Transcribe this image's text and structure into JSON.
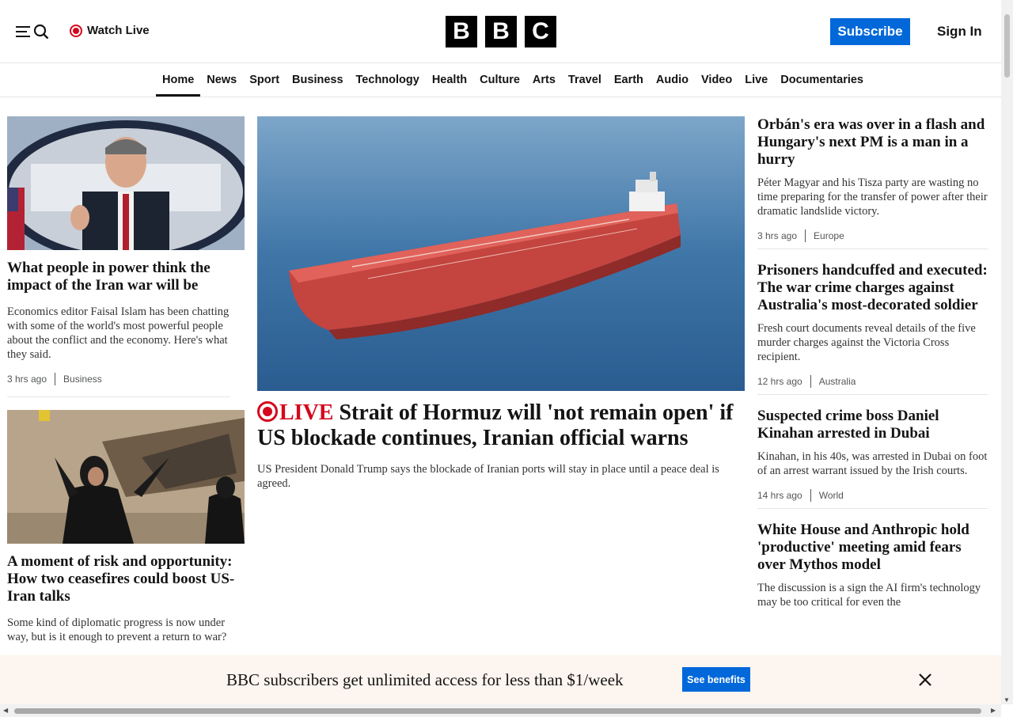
{
  "header": {
    "watch_live": "Watch Live",
    "logo_letters": [
      "B",
      "B",
      "C"
    ],
    "subscribe": "Subscribe",
    "sign_in": "Sign In"
  },
  "nav": [
    "Home",
    "News",
    "Sport",
    "Business",
    "Technology",
    "Health",
    "Culture",
    "Arts",
    "Travel",
    "Earth",
    "Audio",
    "Video",
    "Live",
    "Documentaries"
  ],
  "left": [
    {
      "headline": "What people in power think the impact of the Iran war will be",
      "summary": "Economics editor Faisal Islam has been chatting with some of the world's most powerful people about the conflict and the economy. Here's what they said.",
      "time": "3 hrs ago",
      "section": "Business"
    },
    {
      "headline": "A moment of risk and opportunity: How two ceasefires could boost US-Iran talks",
      "summary": "Some kind of diplomatic progress is now under way, but is it enough to prevent a return to war?"
    }
  ],
  "main": {
    "live_label": "LIVE",
    "headline": "Strait of Hormuz will 'not remain open' if US blockade continues, Iranian official warns",
    "summary": "US President Donald Trump says the blockade of Iranian ports will stay in place until a peace deal is agreed."
  },
  "right": [
    {
      "headline": "Orbán's era was over in a flash and Hungary's next PM is a man in a hurry",
      "summary": "Péter Magyar and his Tisza party are wasting no time preparing for the transfer of power after their dramatic landslide victory.",
      "time": "3 hrs ago",
      "section": "Europe"
    },
    {
      "headline": "Prisoners handcuffed and executed: The war crime charges against Australia's most-decorated soldier",
      "summary": "Fresh court documents reveal details of the five murder charges against the Victoria Cross recipient.",
      "time": "12 hrs ago",
      "section": "Australia"
    },
    {
      "headline": "Suspected crime boss Daniel Kinahan arrested in Dubai",
      "summary": "Kinahan, in his 40s, was arrested in Dubai on foot of an arrest warrant issued by the Irish courts.",
      "time": "14 hrs ago",
      "section": "World"
    },
    {
      "headline": "White House and Anthropic hold 'productive' meeting amid fears over Mythos model",
      "summary": "The discussion is a sign the AI firm's technology may be too critical for even the"
    }
  ],
  "banner": {
    "text": "BBC subscribers get unlimited access for less than $1/week",
    "button": "See benefits"
  },
  "colors": {
    "accent": "#0068d9",
    "live": "#d4071c"
  }
}
